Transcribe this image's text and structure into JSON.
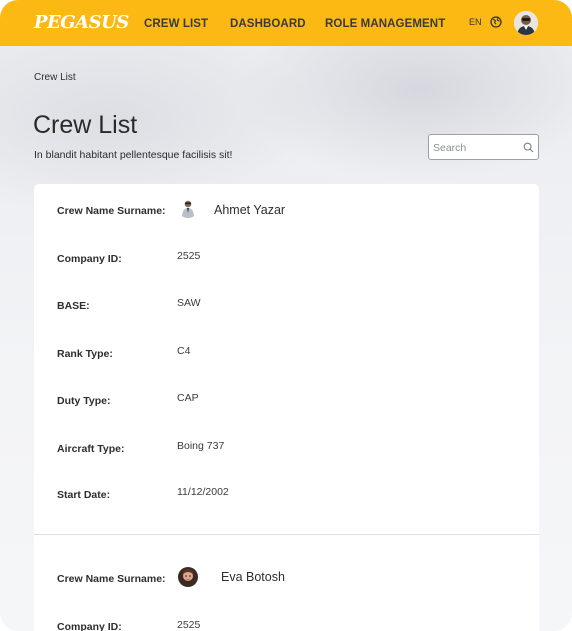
{
  "header": {
    "logo": "PEGASUS",
    "nav": [
      "CREW LIST",
      "DASHBOARD",
      "ROLE MANAGEMENT"
    ],
    "language": "EN",
    "globe_icon": "globe-icon",
    "avatar_icon": "user-avatar-icon"
  },
  "page": {
    "breadcrumb": "Crew List",
    "title": "Crew List",
    "subtitle": "In blandit habitant pellentesque facilisis sit!",
    "search_placeholder": "Search",
    "search_value": ""
  },
  "labels": {
    "name": "Crew Name Surname:",
    "company_id": "Company ID:",
    "base": "BASE:",
    "rank": "Rank Type:",
    "duty": "Duty Type:",
    "aircraft": "Aircraft Type:",
    "start": "Start Date:"
  },
  "crew": [
    {
      "name": "Ahmet Yazar",
      "company_id": "2525",
      "base": "SAW",
      "rank": "C4",
      "duty": "CAP",
      "aircraft": "Boing 737",
      "start": "11/12/2002"
    },
    {
      "name": "Eva Botosh",
      "company_id": "2525"
    }
  ],
  "colors": {
    "brand": "#fdb913",
    "card": "#ffffff",
    "text": "#2e2e2e"
  }
}
